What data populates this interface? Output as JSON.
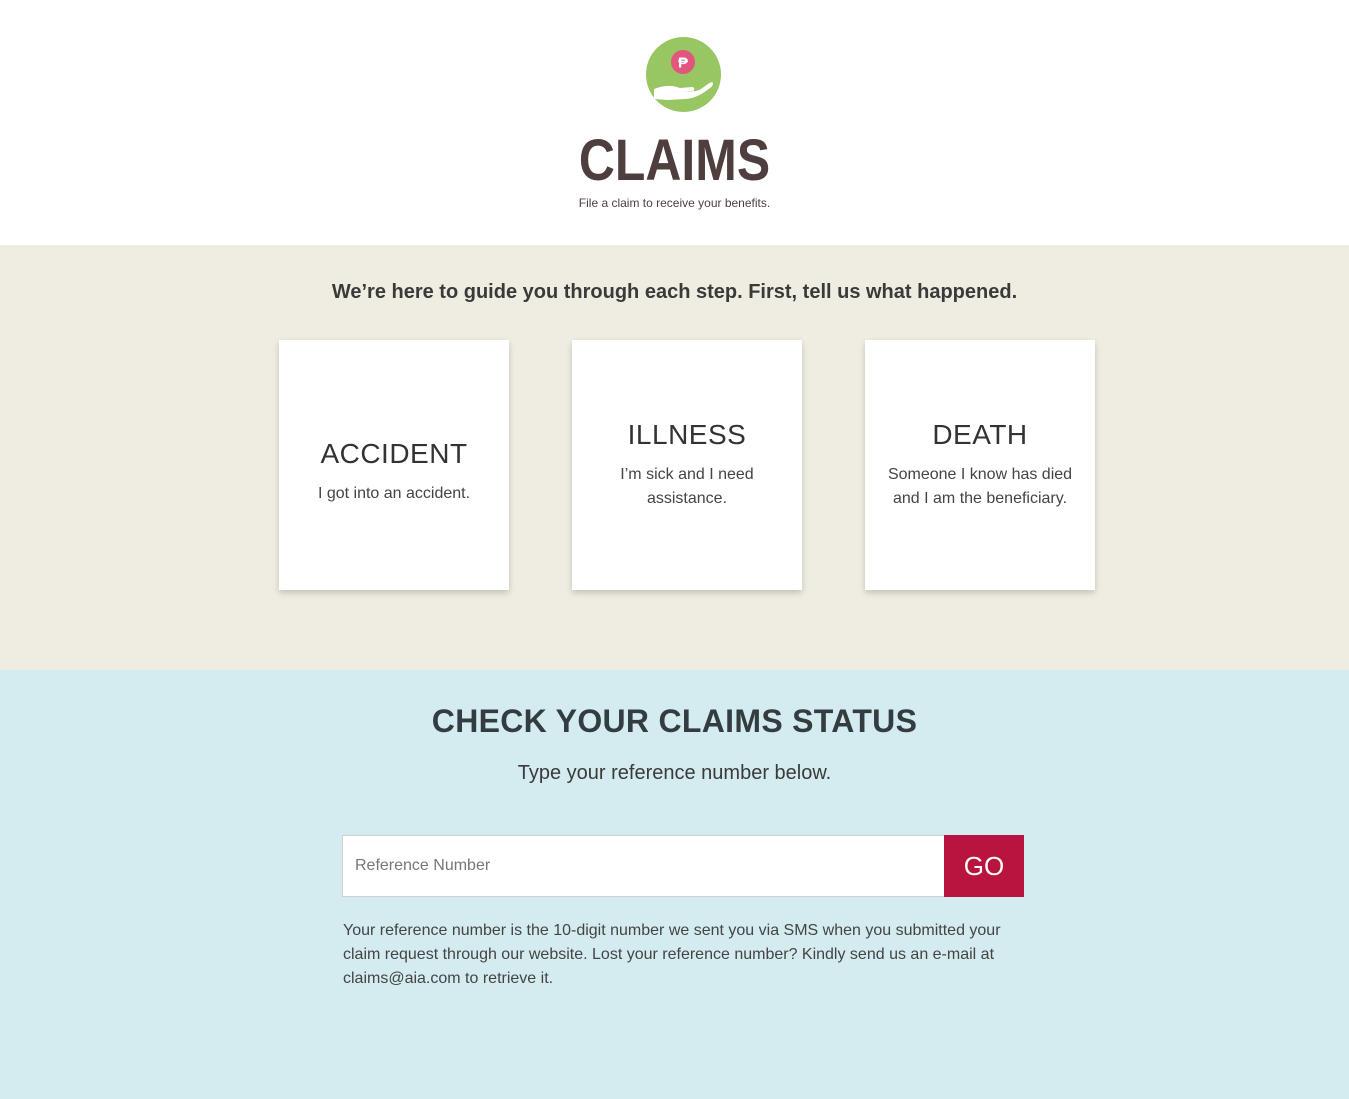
{
  "hero": {
    "title": "CLAIMS",
    "subtitle": "File a claim to receive your benefits.",
    "logo_symbol": "₱",
    "logo_icon": "hand-coin-icon",
    "colors": {
      "logo_green": "#98c663",
      "coin_pink": "#e2557d",
      "title_brown": "#4f3e3e"
    }
  },
  "options": {
    "heading": "We’re here to guide you through each step. First, tell us what happened.",
    "cards": [
      {
        "title": "ACCIDENT",
        "description": "I got into an accident."
      },
      {
        "title": "ILLNESS",
        "description": "I’m sick and I need assistance."
      },
      {
        "title": "DEATH",
        "description": "Someone I know has died and I am the beneficiary."
      }
    ]
  },
  "status": {
    "title": "CHECK YOUR CLAIMS STATUS",
    "subtitle": "Type your reference number below.",
    "input_placeholder": "Reference Number",
    "input_value": "",
    "go_label": "GO",
    "help_text": "Your reference number is the 10-digit number we sent you via SMS when you submitted your claim request through our website. Lost your reference number? Kindly send us an e-mail at claims@aia.com to retrieve it.",
    "colors": {
      "go_button": "#b8143f",
      "background": "#d4ecef"
    }
  }
}
